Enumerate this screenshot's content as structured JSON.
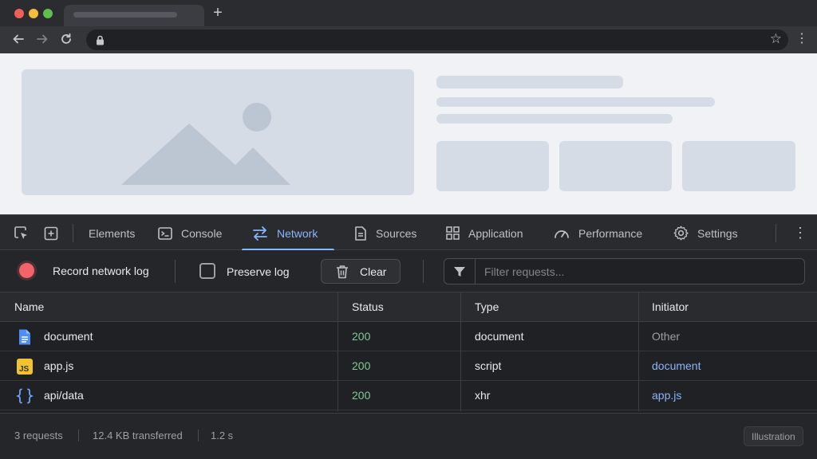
{
  "browser": {
    "tab_title": "",
    "new_tab_symbol": "+",
    "url": "",
    "colors": {
      "close": "#ee5f57",
      "minimize": "#f5bd3d",
      "maximize": "#5fc04e"
    }
  },
  "devtools": {
    "tabs": [
      {
        "label": "Elements",
        "icon": "elements-icon"
      },
      {
        "label": "Console",
        "icon": "console-icon"
      },
      {
        "label": "Network",
        "icon": "network-arrows-icon",
        "active": true
      },
      {
        "label": "Sources",
        "icon": "file-icon"
      },
      {
        "label": "Application",
        "icon": "grid-icon"
      },
      {
        "label": "Performance",
        "icon": "gauge-icon"
      },
      {
        "label": "Settings",
        "icon": "gear-icon"
      }
    ],
    "actions": {
      "record_label": "Record network log",
      "preserve_label": "Preserve log",
      "preserve_checked": false,
      "clear_label": "Clear",
      "filter_placeholder": "Filter requests..."
    },
    "table": {
      "columns": [
        "Name",
        "Status",
        "Type",
        "Initiator"
      ],
      "rows": [
        {
          "icon": "document-file-icon",
          "name": "document",
          "status": "200",
          "type": "document",
          "initiator": "Other"
        },
        {
          "icon": "js-file-icon",
          "name": "app.js",
          "status": "200",
          "type": "script",
          "initiator": "document"
        },
        {
          "icon": "braces-icon",
          "name": "api/data",
          "status": "200",
          "type": "xhr",
          "initiator": "app.js"
        }
      ]
    },
    "footer": {
      "requests": "3 requests",
      "transferred": "12.4 KB transferred",
      "time": "1.2 s",
      "badge": "Illustration"
    }
  },
  "accent_color": "#8ab4f8"
}
